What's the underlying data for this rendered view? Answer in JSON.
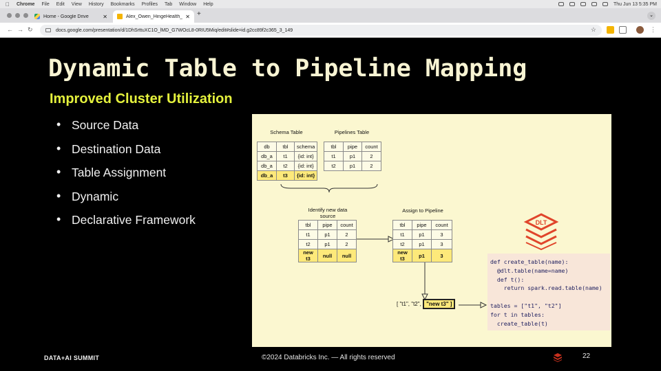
{
  "menubar": {
    "app": "Chrome",
    "items": [
      "File",
      "Edit",
      "View",
      "History",
      "Bookmarks",
      "Profiles",
      "Tab",
      "Window",
      "Help"
    ],
    "clock": "Thu Jun 13  5:35 PM"
  },
  "tabs": [
    {
      "label": "Home - Google Drive",
      "close": "✕"
    },
    {
      "label": "Alex_Owen_HingeHealth_Da",
      "close": "✕"
    }
  ],
  "new_tab": "+",
  "tab_menu": "⌄",
  "address": {
    "url": "docs.google.com/presentation/d/1DhSrttuXC1O_lMD_G7WOcL8-0RIU5Miq/edit#slide=id.g2cc89f2c365_3_149"
  },
  "slide": {
    "title": "Dynamic Table to Pipeline Mapping",
    "subtitle": "Improved Cluster Utilization",
    "bullets": [
      "Source Data",
      "Destination Data",
      "Table Assignment",
      "Dynamic",
      "Declarative Framework"
    ],
    "diagram": {
      "schema_table": {
        "label": "Schema Table",
        "headers": [
          "db",
          "tbl",
          "schema"
        ],
        "rows": [
          [
            "db_a",
            "t1",
            "{id: int}"
          ],
          [
            "db_a",
            "t2",
            "{id: int}"
          ],
          [
            "db_a",
            "t3",
            "{id: int}"
          ]
        ]
      },
      "pipelines_table": {
        "label": "Pipelines Table",
        "headers": [
          "tbl",
          "pipe",
          "count"
        ],
        "rows": [
          [
            "t1",
            "p1",
            "2"
          ],
          [
            "t2",
            "p1",
            "2"
          ]
        ]
      },
      "identify_table": {
        "label_line1": "Identify new data",
        "label_line2": "source",
        "headers": [
          "tbl",
          "pipe",
          "count"
        ],
        "rows": [
          [
            "t1",
            "p1",
            "2"
          ],
          [
            "t2",
            "p1",
            "2"
          ],
          [
            "new t3",
            "null",
            "null"
          ]
        ]
      },
      "assign_table": {
        "label": "Assign to Pipeline",
        "headers": [
          "tbl",
          "pipe",
          "count"
        ],
        "rows": [
          [
            "t1",
            "p1",
            "3"
          ],
          [
            "t2",
            "p1",
            "3"
          ],
          [
            "new t3",
            "p1",
            "3"
          ]
        ]
      },
      "list_expr": {
        "prefix": "[ \"t1\", \"t2\",",
        "highlight": "\"new t3\" ]"
      },
      "code": [
        "def create_table(name):",
        "  @dlt.table(name=name)",
        "  def t():",
        "    return spark.read.table(name)",
        "",
        "tables = [\"t1\", \"t2\"]",
        "for t in tables:",
        "  create_table(t)"
      ],
      "logo_text": "DLT"
    },
    "footer": {
      "brand": "DATA+AI SUMMIT",
      "copyright": "©2024 Databricks Inc. — All rights reserved",
      "page": "22"
    }
  }
}
